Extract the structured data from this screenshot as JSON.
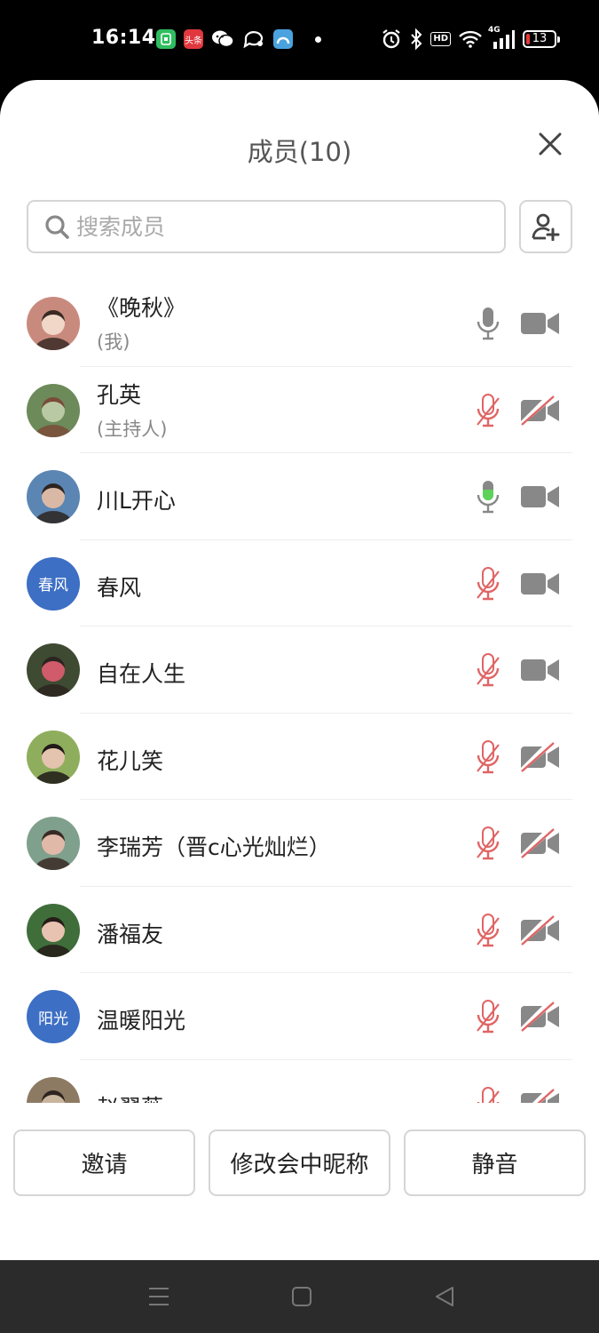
{
  "status_bar": {
    "time": "16:14",
    "left_icons": [
      "carrier-app-icon",
      "toutiao-app-icon",
      "wechat-icon",
      "chat-bubble-icon",
      "browser-app-icon",
      "notification-dot"
    ],
    "toutiao_label": "头条",
    "right_icons": [
      "alarm-icon",
      "bluetooth-icon",
      "hd-icon",
      "wifi-icon",
      "signal-4g-icon",
      "battery-icon"
    ],
    "hd_label": "HD",
    "network_label": "4G",
    "battery_level": "13",
    "battery_color": "#e53935"
  },
  "header": {
    "title": "成员(10)",
    "close_icon": "close-icon"
  },
  "search": {
    "placeholder": "搜索成员",
    "icon": "search-icon",
    "add_member_icon": "add-person-icon"
  },
  "members": [
    {
      "name": "《晚秋》",
      "sub": "(我)",
      "avatar_text": "",
      "mic": "on",
      "camera": "on"
    },
    {
      "name": "孔英",
      "sub": "(主持人)",
      "avatar_text": "",
      "mic": "muted",
      "camera": "off"
    },
    {
      "name": "川L开心",
      "sub": "",
      "avatar_text": "",
      "mic": "speaking",
      "camera": "on"
    },
    {
      "name": "春风",
      "sub": "",
      "avatar_text": "春风",
      "mic": "muted",
      "camera": "on"
    },
    {
      "name": "自在人生",
      "sub": "",
      "avatar_text": "",
      "mic": "muted",
      "camera": "on"
    },
    {
      "name": "花儿笑",
      "sub": "",
      "avatar_text": "",
      "mic": "muted",
      "camera": "off"
    },
    {
      "name": "李瑞芳（晋c心光灿烂）",
      "sub": "",
      "avatar_text": "",
      "mic": "muted",
      "camera": "off"
    },
    {
      "name": "潘福友",
      "sub": "",
      "avatar_text": "",
      "mic": "muted",
      "camera": "off"
    },
    {
      "name": "温暖阳光",
      "sub": "",
      "avatar_text": "阳光",
      "mic": "muted",
      "camera": "off"
    },
    {
      "name": "赵翠薇",
      "sub": "",
      "avatar_text": "",
      "mic": "muted",
      "camera": "off"
    }
  ],
  "footer": {
    "invite_label": "邀请",
    "rename_label": "修改会中昵称",
    "mute_label": "静音"
  },
  "colors": {
    "icon_gray": "#888888",
    "muted_red": "#e06565",
    "speaking_green": "#5ed35a",
    "avatar_blue": "#3d6fc4"
  },
  "nav_bar": {
    "icons": [
      "menu-icon",
      "home-icon",
      "back-icon"
    ]
  }
}
